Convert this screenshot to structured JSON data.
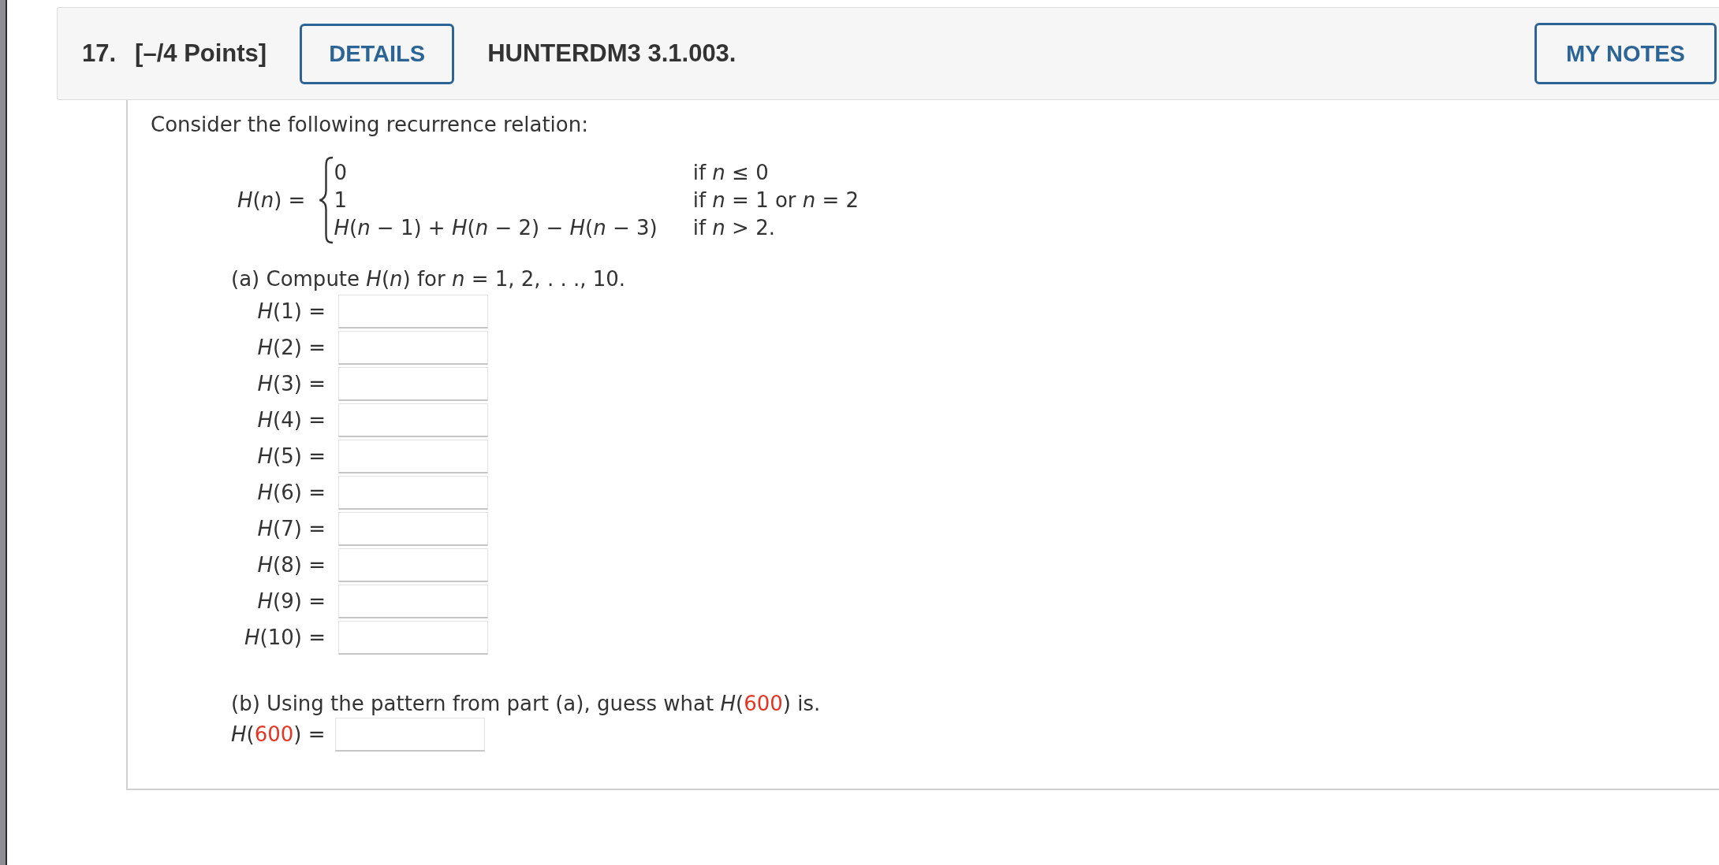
{
  "header": {
    "number": "17.",
    "points": "[–/4 Points]",
    "details_button": "DETAILS",
    "problem_id": "HUNTERDM3 3.1.003.",
    "notes_button": "MY NOTES"
  },
  "intro": "Consider the following recurrence relation:",
  "definition": {
    "function": "*H*(*n*) =",
    "cases": [
      {
        "value": "0",
        "condition": "if *n* ≤ 0"
      },
      {
        "value": "1",
        "condition": "if *n* = 1 or *n* = 2"
      },
      {
        "value": "*H*(*n* − 1) + *H*(*n* − 2) − *H*(*n* − 3)",
        "condition": "if *n* > 2."
      }
    ]
  },
  "part_a": {
    "prompt": "(a) Compute *H*(*n*) for *n* = 1, 2, . . ., 10.",
    "answers": [
      {
        "label": "*H*(1) ="
      },
      {
        "label": "*H*(2) ="
      },
      {
        "label": "*H*(3) ="
      },
      {
        "label": "*H*(4) ="
      },
      {
        "label": "*H*(5) ="
      },
      {
        "label": "*H*(6) ="
      },
      {
        "label": "*H*(7) ="
      },
      {
        "label": "*H*(8) ="
      },
      {
        "label": "*H*(9) ="
      },
      {
        "label": "*H*(10) ="
      }
    ]
  },
  "part_b": {
    "prompt": [
      {
        "text": "(b) Using the pattern from part (a), guess what *H*(",
        "kind": "plain"
      },
      {
        "text": "600",
        "kind": "highlighted"
      },
      {
        "text": ") is.",
        "kind": "plain"
      }
    ],
    "answer": {
      "label": [
        {
          "text": "*H*(",
          "kind": "plain"
        },
        {
          "text": "600",
          "kind": "highlighted"
        },
        {
          "text": ") =",
          "kind": "plain"
        }
      ]
    }
  }
}
